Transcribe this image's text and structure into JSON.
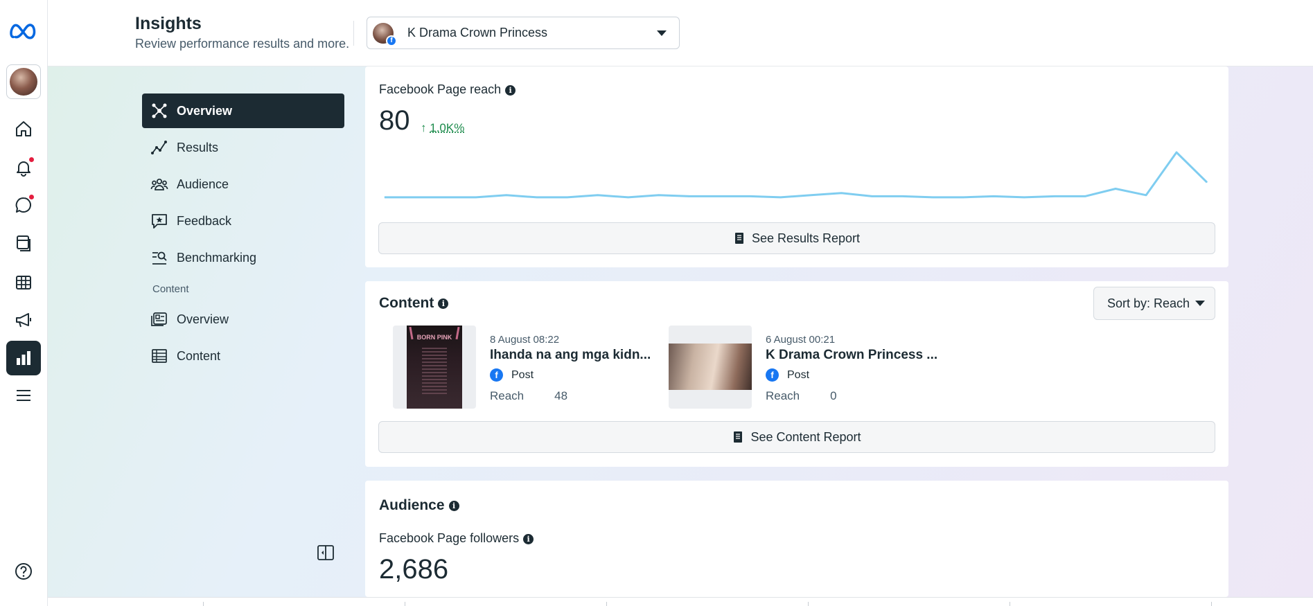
{
  "header": {
    "title": "Insights",
    "subtitle": "Review performance results and more.",
    "page_selector": {
      "name": "K Drama Crown Princess"
    }
  },
  "rail": {
    "items": [
      "meta-logo",
      "profile-avatar",
      "home-icon",
      "notifications-icon",
      "messages-icon",
      "pages-icon",
      "table-icon",
      "megaphone-icon",
      "insights-icon",
      "menu-icon",
      "help-icon"
    ],
    "active": "insights-icon"
  },
  "nav": {
    "items": [
      {
        "label": "Overview",
        "icon": "overview-icon",
        "active": true
      },
      {
        "label": "Results",
        "icon": "results-icon"
      },
      {
        "label": "Audience",
        "icon": "audience-icon"
      },
      {
        "label": "Feedback",
        "icon": "feedback-icon"
      },
      {
        "label": "Benchmarking",
        "icon": "benchmarking-icon"
      }
    ],
    "section_label": "Content",
    "content_items": [
      {
        "label": "Overview",
        "icon": "content-overview-icon"
      },
      {
        "label": "Content",
        "icon": "content-table-icon"
      }
    ]
  },
  "reach": {
    "label": "Facebook Page reach",
    "value": "80",
    "delta": "1.0K%",
    "report_button": "See Results Report"
  },
  "chart_data": {
    "type": "line",
    "title": "",
    "xlabel": "",
    "ylabel": "",
    "color": "#7fcdf0",
    "series": [
      {
        "values": [
          1,
          1,
          1,
          1,
          2,
          1,
          1,
          2,
          1,
          2,
          1.5,
          1.5,
          1.5,
          1,
          2,
          3,
          1.5,
          1.5,
          1,
          1,
          1.5,
          1,
          1.5,
          1.5,
          5,
          2,
          22,
          8
        ]
      }
    ],
    "grid": false
  },
  "content": {
    "title": "Content",
    "sort_label": "Sort by: Reach",
    "posts": [
      {
        "date": "8 August 08:22",
        "text": "Ihanda na ang mga kidn...",
        "type": "Post",
        "metric_label": "Reach",
        "metric_value": "48",
        "thumb_text": "BORN PINK"
      },
      {
        "date": "6 August 00:21",
        "text": "K Drama Crown Princess ...",
        "type": "Post",
        "metric_label": "Reach",
        "metric_value": "0"
      }
    ],
    "report_button": "See Content Report"
  },
  "audience": {
    "title": "Audience",
    "followers_label": "Facebook Page followers",
    "followers_value": "2,686"
  },
  "colors": {
    "dark": "#1c2b33",
    "accent": "#1877f2",
    "positive": "#1a8a4a",
    "line": "#7fcdf0",
    "badge": "#e41e3f"
  }
}
